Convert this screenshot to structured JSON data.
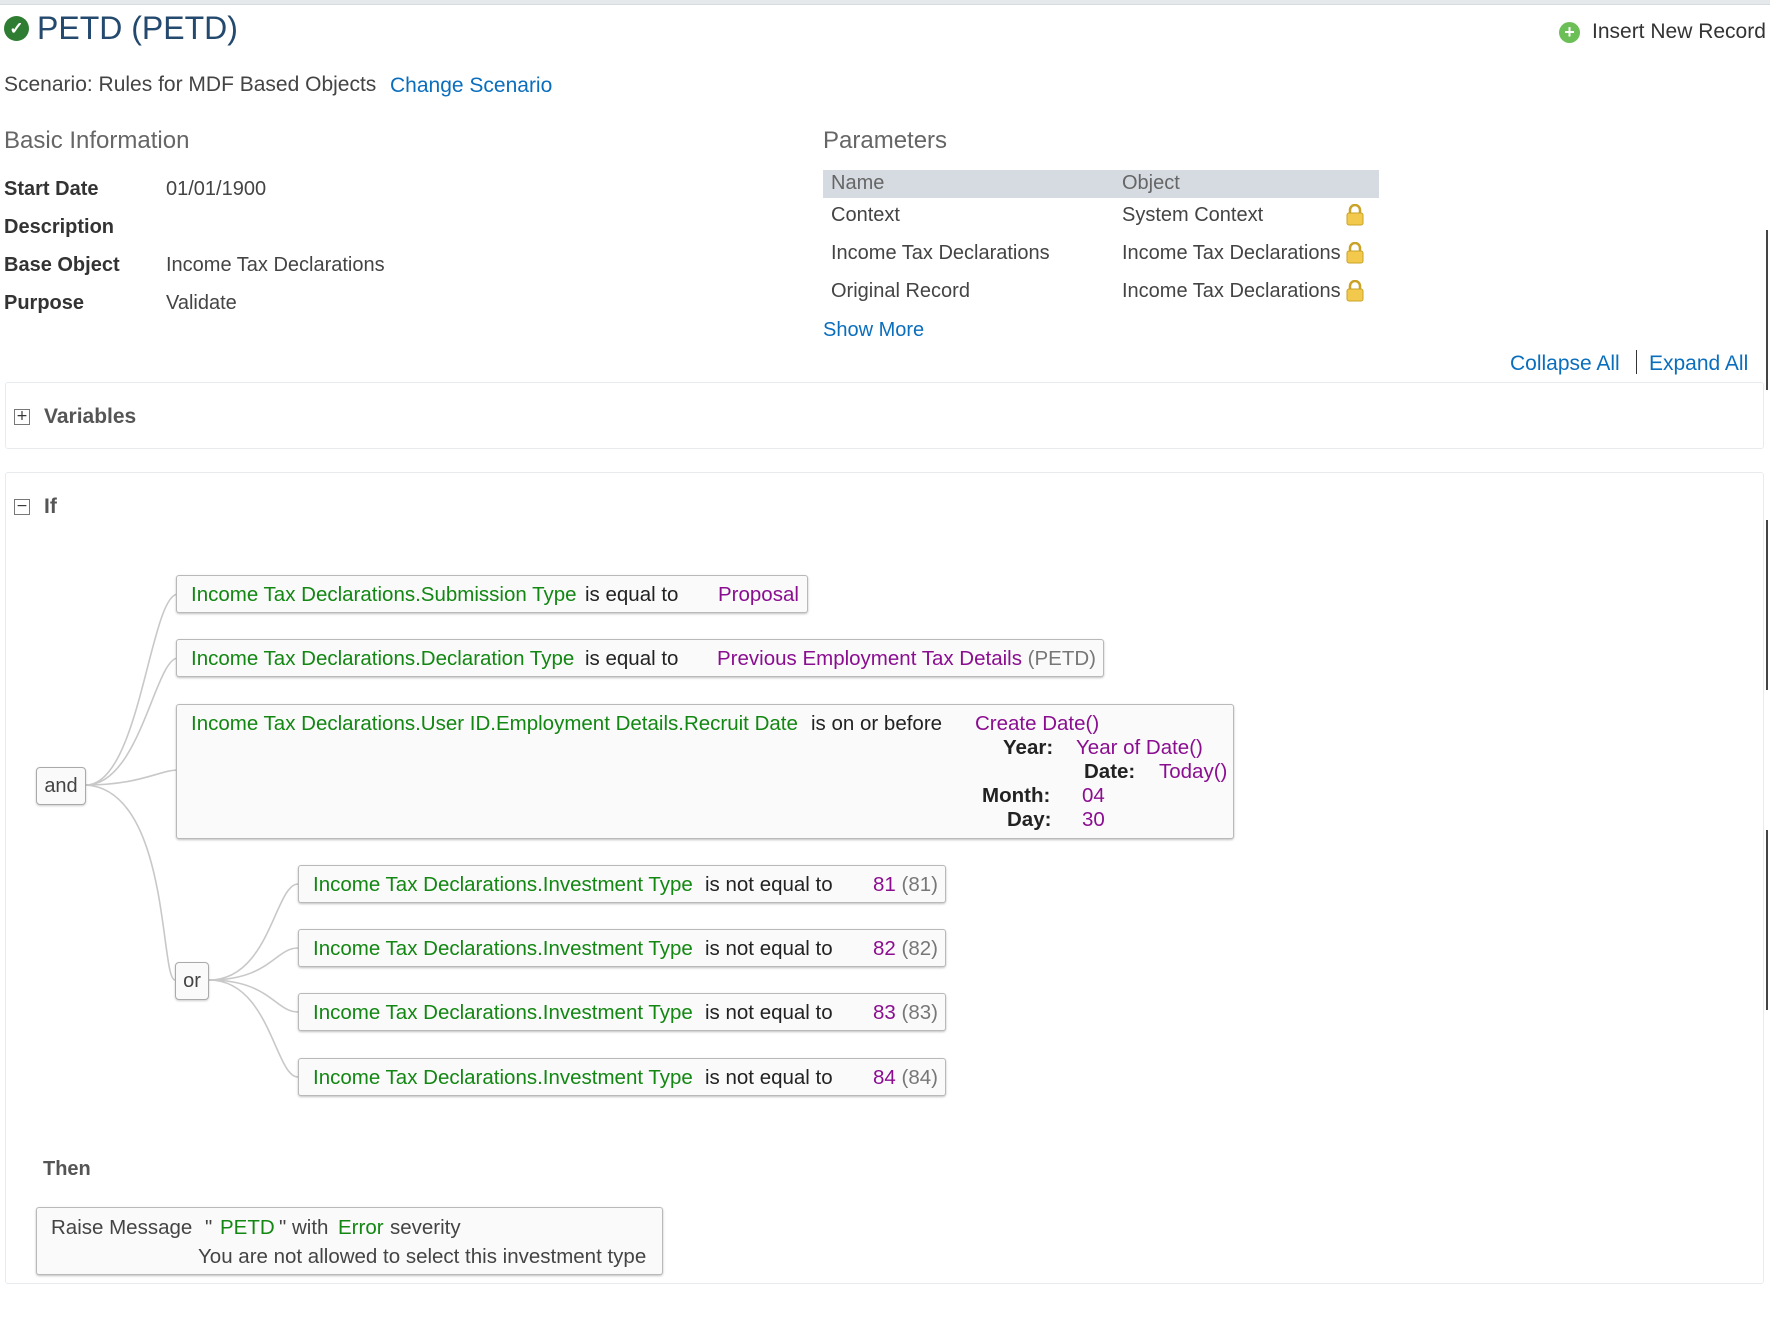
{
  "header": {
    "title": "PETD (PETD)",
    "insert_label": "Insert New Record",
    "scenario_label": "Scenario: Rules for MDF Based Objects",
    "change_scenario": "Change Scenario"
  },
  "basic_info": {
    "heading": "Basic Information",
    "rows": [
      {
        "label": "Start Date",
        "value": "01/01/1900"
      },
      {
        "label": "Description",
        "value": ""
      },
      {
        "label": "Base Object",
        "value": "Income Tax Declarations"
      },
      {
        "label": "Purpose",
        "value": "Validate"
      }
    ]
  },
  "parameters": {
    "heading": "Parameters",
    "columns": [
      "Name",
      "Object"
    ],
    "rows": [
      {
        "name": "Context",
        "object": "System Context"
      },
      {
        "name": "Income Tax Declarations",
        "object": "Income Tax Declarations"
      },
      {
        "name": "Original Record",
        "object": "Income Tax Declarations"
      }
    ],
    "show_more": "Show More"
  },
  "tree_controls": {
    "collapse_all": "Collapse All",
    "expand_all": "Expand All"
  },
  "variables": {
    "title": "Variables",
    "toggle": "+"
  },
  "if_block": {
    "title": "If",
    "toggle": "−",
    "and_label": "and",
    "or_label": "or",
    "conditions": [
      {
        "field": "Income Tax Declarations.Submission Type",
        "operator": "is equal to",
        "value": "Proposal",
        "code": ""
      },
      {
        "field": "Income Tax Declarations.Declaration Type",
        "operator": "is equal to",
        "value": "Previous Employment Tax Details",
        "code": "(PETD)"
      }
    ],
    "date_condition": {
      "field": "Income Tax Declarations.User ID.Employment Details.Recruit Date",
      "operator": "is on or before",
      "func": "Create Date()",
      "year_label": "Year:",
      "year_value": "Year of Date()",
      "date_label": "Date:",
      "date_value": "Today()",
      "month_label": "Month:",
      "month_value": "04",
      "day_label": "Day:",
      "day_value": "30"
    },
    "or_conditions": [
      {
        "field": "Income Tax Declarations.Investment Type",
        "operator": "is not equal to",
        "value": "81",
        "code": "(81)"
      },
      {
        "field": "Income Tax Declarations.Investment Type",
        "operator": "is not equal to",
        "value": "82",
        "code": "(82)"
      },
      {
        "field": "Income Tax Declarations.Investment Type",
        "operator": "is not equal to",
        "value": "83",
        "code": "(83)"
      },
      {
        "field": "Income Tax Declarations.Investment Type",
        "operator": "is not equal to",
        "value": "84",
        "code": "(84)"
      }
    ]
  },
  "then_block": {
    "title": "Then",
    "action": "Raise Message",
    "quote_open": "\"",
    "message_code": "PETD",
    "quote_close": "\" with",
    "severity": "Error",
    "severity_suffix": "severity",
    "message_text": "You are not allowed to select this investment type"
  },
  "colors": {
    "field": "#128712",
    "value": "#8b0e91",
    "link": "#0a6ebd",
    "title": "#24496e"
  },
  "icons": {
    "status": "check-circle-icon",
    "insert": "plus-circle-icon",
    "lock": "lock-icon"
  }
}
